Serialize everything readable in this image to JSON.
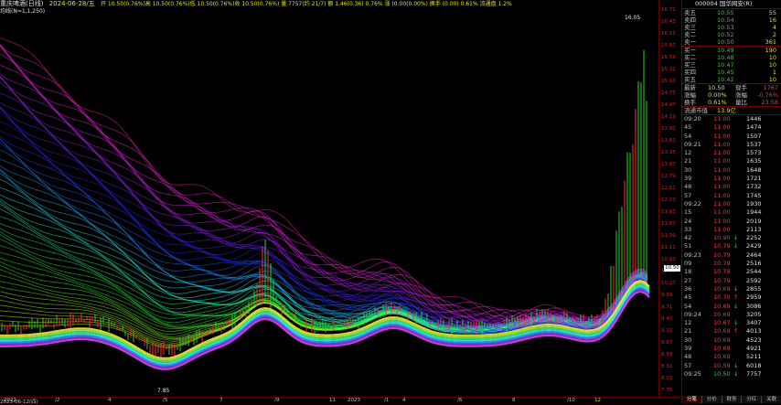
{
  "topbar": {
    "title": "重庆啤酒(日线)",
    "date": "2024-06-28/五",
    "info": "开 10.50(0.76%)高 10.50(0.76%)低 10.50(0.76%)收 10.50(0.76%) 量 7757(约 21/7) 额 1.46(0.36) 0.76% 涨 (0.00(0.00%) 换手 (0.00) 0.61% 流通盘 1.2%"
  },
  "indicator_line": "均线(N=1,1,250)",
  "chart": {
    "high_label": "16.05",
    "low_label": "7.85",
    "current_price": "10.50",
    "price_axis": [
      "16.71",
      "16.43",
      "16.15",
      "15.87",
      "15.59",
      "15.31",
      "15.03",
      "14.75",
      "14.47",
      "14.19",
      "13.91",
      "13.63",
      "13.35",
      "13.07",
      "12.79",
      "12.51",
      "12.23",
      "11.95",
      "11.67",
      "11.39",
      "11.11",
      "10.83",
      "10.55",
      "10.27",
      "9.99",
      "9.71",
      "9.43",
      "9.15",
      "8.87",
      "8.59",
      "8.31",
      "8.03",
      "7.75"
    ],
    "date_axis": [
      "2022",
      "/2",
      "4",
      "/5",
      "7",
      "/9",
      "11",
      "/1",
      "2023",
      "4",
      "/6",
      "8",
      "/10",
      "12",
      "2023-06-12(四)"
    ]
  },
  "quote": {
    "header": "000004 国华网安(R)",
    "asks": [
      {
        "label": "卖五",
        "price": "10.55",
        "vol": "55"
      },
      {
        "label": "卖四",
        "price": "10.54",
        "vol": "16"
      },
      {
        "label": "卖三",
        "price": "10.53",
        "vol": "4"
      },
      {
        "label": "卖二",
        "price": "10.52",
        "vol": "2"
      },
      {
        "label": "卖一",
        "price": "10.50",
        "vol": "361"
      }
    ],
    "bids": [
      {
        "label": "买一",
        "price": "10.49",
        "vol": "190"
      },
      {
        "label": "买二",
        "price": "10.48",
        "vol": "10"
      },
      {
        "label": "买三",
        "price": "10.47",
        "vol": "10"
      },
      {
        "label": "买四",
        "price": "10.45",
        "vol": "1"
      },
      {
        "label": "买五",
        "price": "10.42",
        "vol": "10"
      }
    ],
    "stats": [
      {
        "l1": "最新",
        "v1": "10.50",
        "l2": "现手",
        "v2": "1767"
      },
      {
        "l1": "涨幅",
        "v1": "0.00%",
        "l2": "涨幅",
        "v2": "-0.76%"
      },
      {
        "l1": "换手",
        "v1": "0.61%",
        "l2": "量比",
        "v2": "23.58"
      }
    ],
    "float_label": "流通市值",
    "float_value": "13.9亿"
  },
  "ticks": [
    {
      "t": "09:20",
      "p": "11.00",
      "v": "1446",
      "a": ""
    },
    {
      "t": "45",
      "p": "11.00",
      "v": "1474",
      "a": ""
    },
    {
      "t": "54",
      "p": "11.00",
      "v": "1507",
      "a": ""
    },
    {
      "t": "09:21",
      "p": "11.00",
      "v": "1537",
      "a": ""
    },
    {
      "t": "12",
      "p": "11.00",
      "v": "1573",
      "a": ""
    },
    {
      "t": "21",
      "p": "11.00",
      "v": "1635",
      "a": ""
    },
    {
      "t": "30",
      "p": "11.00",
      "v": "1648",
      "a": ""
    },
    {
      "t": "39",
      "p": "11.00",
      "v": "1721",
      "a": ""
    },
    {
      "t": "48",
      "p": "11.00",
      "v": "1732",
      "a": ""
    },
    {
      "t": "57",
      "p": "11.00",
      "v": "1745",
      "a": ""
    },
    {
      "t": "09:22",
      "p": "11.00",
      "v": "1930",
      "a": ""
    },
    {
      "t": "15",
      "p": "11.00",
      "v": "1944",
      "a": ""
    },
    {
      "t": "24",
      "p": "11.00",
      "v": "2019",
      "a": ""
    },
    {
      "t": "33",
      "p": "11.00",
      "v": "2113",
      "a": ""
    },
    {
      "t": "42",
      "p": "10.90",
      "v": "2252",
      "a": "↓"
    },
    {
      "t": "51",
      "p": "10.79",
      "v": "2429",
      "a": "↓"
    },
    {
      "t": "09:23",
      "p": "10.79",
      "v": "2464",
      "a": ""
    },
    {
      "t": "09",
      "p": "10.79",
      "v": "2516",
      "a": ""
    },
    {
      "t": "18",
      "p": "10.79",
      "v": "2544",
      "a": ""
    },
    {
      "t": "27",
      "p": "10.79",
      "v": "2592",
      "a": ""
    },
    {
      "t": "36",
      "p": "10.69",
      "v": "2855",
      "a": "↓"
    },
    {
      "t": "45",
      "p": "10.70",
      "v": "2959",
      "a": "↑"
    },
    {
      "t": "54",
      "p": "10.69",
      "v": "3086",
      "a": "↓"
    },
    {
      "t": "09:24",
      "p": "10.69",
      "v": "3205",
      "a": ""
    },
    {
      "t": "12",
      "p": "10.67",
      "v": "3407",
      "a": "↓"
    },
    {
      "t": "21",
      "p": "10.69",
      "v": "4013",
      "a": "↑"
    },
    {
      "t": "30",
      "p": "10.69",
      "v": "4523",
      "a": ""
    },
    {
      "t": "39",
      "p": "10.69",
      "v": "4921",
      "a": ""
    },
    {
      "t": "48",
      "p": "10.69",
      "v": "5211",
      "a": ""
    },
    {
      "t": "57",
      "p": "10.59",
      "v": "6018",
      "a": "↓"
    },
    {
      "t": "09:25",
      "p": "10.50",
      "v": "7757",
      "a": "↓"
    }
  ],
  "tabs": [
    "分笔",
    "分价",
    "财务",
    "分红",
    "关联"
  ],
  "colors": {
    "up": "#ff3030",
    "down": "#40c040",
    "accent": "#e0e020",
    "bg": "#000000"
  }
}
